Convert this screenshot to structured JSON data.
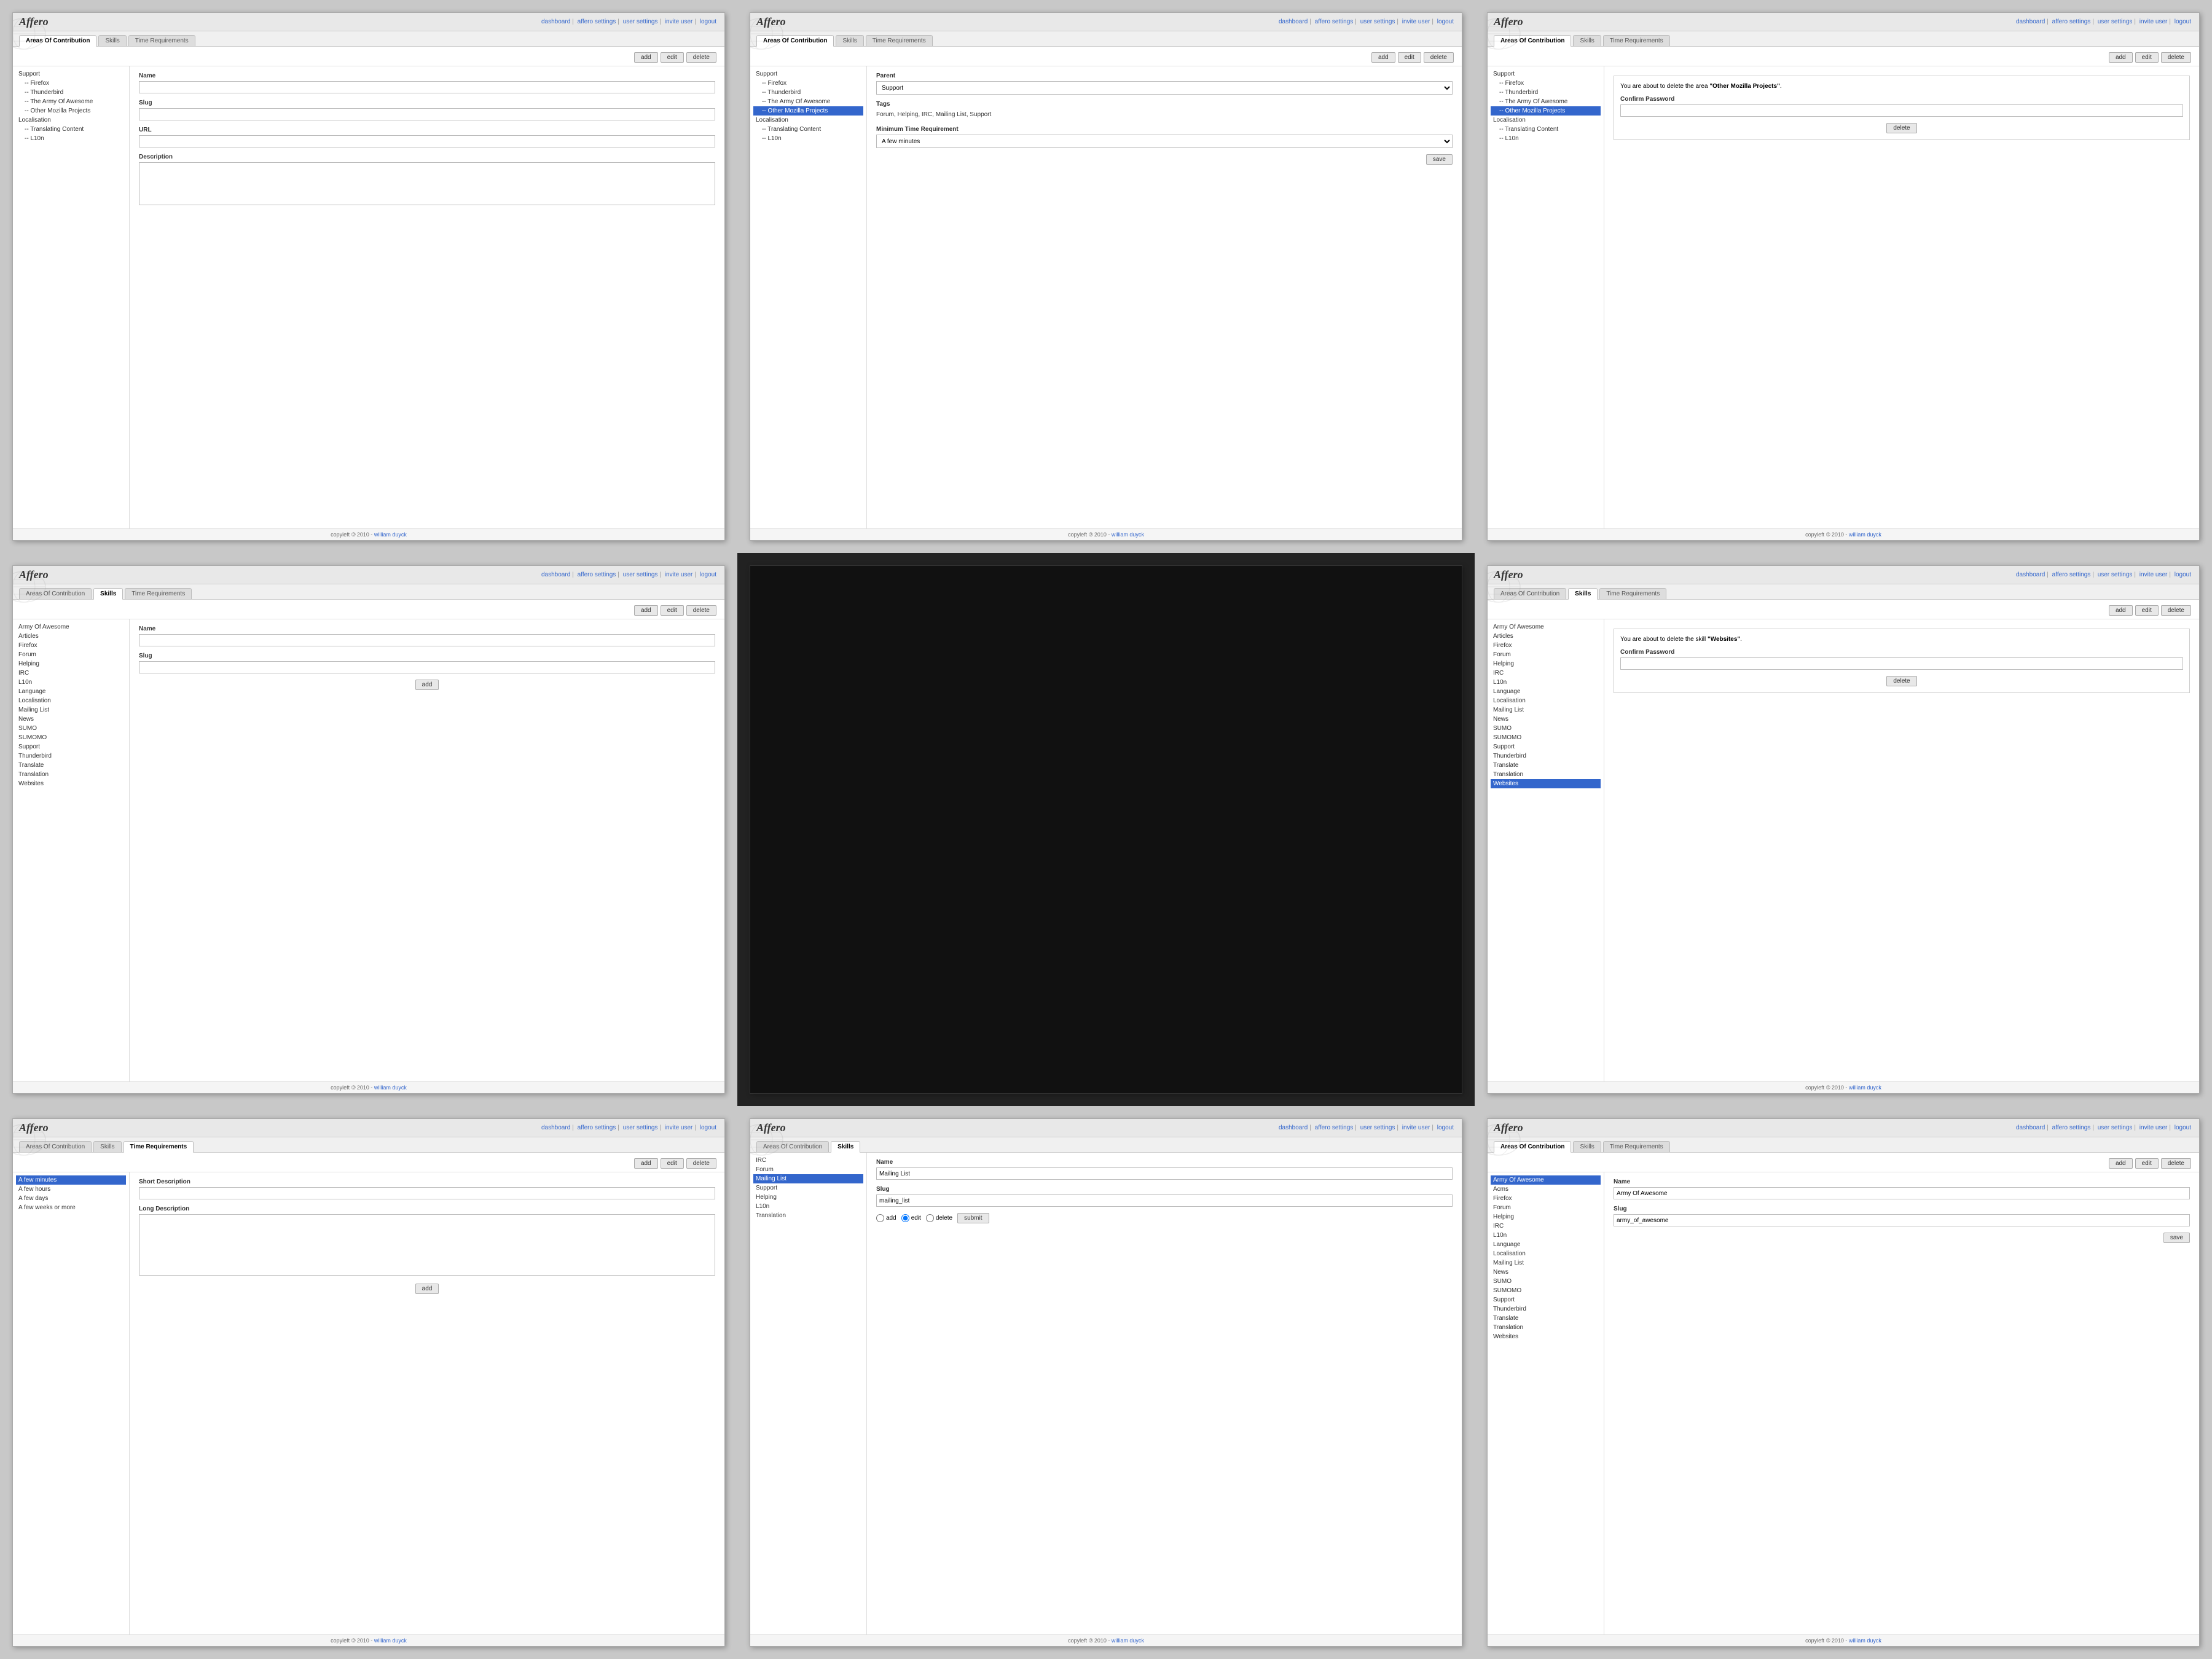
{
  "nav": {
    "links": [
      "dashboard",
      "affero settings",
      "user settings",
      "invite user",
      "logout"
    ]
  },
  "logo": "Affero",
  "tabs": {
    "areas": "Areas Of Contribution",
    "skills": "Skills",
    "time": "Time Requirements"
  },
  "footer": {
    "text": "copyleft",
    "year": "2010",
    "author": "william duyck"
  },
  "cells": [
    {
      "id": "cell-1",
      "activeTab": "areas",
      "list": [
        {
          "label": "Support",
          "indent": 0
        },
        {
          "label": "-- Firefox",
          "indent": 1
        },
        {
          "label": "-- Thunderbird",
          "indent": 1
        },
        {
          "label": "-- The Army Of Awesome",
          "indent": 1
        },
        {
          "label": "-- Other Mozilla Projects",
          "indent": 1
        },
        {
          "label": "Localisation",
          "indent": 0
        },
        {
          "label": "-- Translating Content",
          "indent": 1
        },
        {
          "label": "-- L10n",
          "indent": 1
        }
      ],
      "form": {
        "fields": [
          "Name",
          "Slug",
          "URL",
          "Description"
        ],
        "hasTextarea": true,
        "buttons": [
          "add",
          "edit",
          "delete"
        ]
      }
    },
    {
      "id": "cell-2",
      "activeTab": "areas",
      "list": [
        {
          "label": "Support",
          "indent": 0
        },
        {
          "label": "-- Firefox",
          "indent": 1
        },
        {
          "label": "-- Thunderbird",
          "indent": 1
        },
        {
          "label": "-- The Army Of Awesome",
          "indent": 1
        },
        {
          "label": "-- Other Mozilla Projects",
          "indent": 1,
          "selected": true
        },
        {
          "label": "Localisation",
          "indent": 0
        },
        {
          "label": "-- Translating Content",
          "indent": 1
        },
        {
          "label": "-- L10n",
          "indent": 1
        }
      ],
      "form": {
        "parent": "Support",
        "tags": "Forum, Helping, IRC, Mailing List, Support",
        "minTime": "A few minutes",
        "button": "save",
        "buttons": [
          "add",
          "edit",
          "delete"
        ]
      }
    },
    {
      "id": "cell-3",
      "activeTab": "areas",
      "list": [
        {
          "label": "Support",
          "indent": 0
        },
        {
          "label": "-- Firefox",
          "indent": 1
        },
        {
          "label": "-- Thunderbird",
          "indent": 1
        },
        {
          "label": "-- The Army Of Awesome",
          "indent": 1
        },
        {
          "label": "-- Other Mozilla Projects",
          "indent": 1,
          "selected": true
        },
        {
          "label": "Localisation",
          "indent": 0
        },
        {
          "label": "-- Translating Content",
          "indent": 1
        },
        {
          "label": "-- L10n",
          "indent": 1
        }
      ],
      "confirm": {
        "message": "You are about to delete the area \"Other Mozilla Projects\".",
        "label": "Confirm Password",
        "button": "delete"
      },
      "buttons": [
        "add",
        "edit",
        "delete"
      ]
    },
    {
      "id": "cell-4",
      "activeTab": "skills",
      "list": [
        "Army Of Awesome",
        "Articles",
        "Firefox",
        "Forum",
        "Helping",
        "IRC",
        "L10n",
        "Language",
        "Localisation",
        "Mailing List",
        "News",
        "SUMO",
        "SUMOMO",
        "Support",
        "Thunderbird",
        "Translate",
        "Translation",
        "Websites"
      ],
      "form": {
        "fields": [
          "Name",
          "Slug"
        ],
        "button": "add",
        "buttons": [
          "add",
          "edit",
          "delete"
        ]
      }
    },
    {
      "id": "cell-5",
      "type": "black"
    },
    {
      "id": "cell-6",
      "activeTab": "skills",
      "list": [
        "Army Of Awesome",
        "Articles",
        "Firefox",
        "Forum",
        "Helping",
        "IRC",
        "L10n",
        "Language",
        "Localisation",
        "Mailing List",
        "News",
        "SUMO",
        "SUMOMO",
        "Support",
        "Thunderbird",
        "Translate",
        "Translation",
        "Websites"
      ],
      "selectedItem": "Websites",
      "confirm": {
        "message": "You are about to delete the skill \"Websites\".",
        "label": "Confirm Password",
        "button": "delete"
      },
      "buttons": [
        "add",
        "edit",
        "delete"
      ]
    },
    {
      "id": "cell-7",
      "activeTab": "time",
      "list": [
        {
          "label": "A few minutes",
          "selected": true
        },
        {
          "label": "A few hours"
        },
        {
          "label": "A few days"
        },
        {
          "label": "A few weeks or more"
        }
      ],
      "form": {
        "fields": [
          "Short Description",
          "Long Description"
        ],
        "hasTextarea": true,
        "button": "add",
        "buttons": [
          "add",
          "edit",
          "delete"
        ]
      }
    },
    {
      "id": "cell-8",
      "activeTab": "areas_skills",
      "tabs": [
        "Areas Of Contribution",
        "Skills"
      ],
      "activeTabIndex": 1,
      "list": [
        {
          "label": "IRC"
        },
        {
          "label": "Forum"
        },
        {
          "label": "Mailing List",
          "selected": true
        },
        {
          "label": "Support"
        },
        {
          "label": "Helping"
        },
        {
          "label": "L10n"
        },
        {
          "label": "Translation"
        }
      ],
      "form": {
        "nameVal": "Mailing List",
        "slugVal": "mailing_list",
        "radioOptions": [
          "add",
          "edit",
          "delete"
        ],
        "button": "submit"
      }
    },
    {
      "id": "cell-9",
      "activeTab": "areas",
      "list": [
        {
          "label": "Army Of Awesome",
          "selected": true
        },
        {
          "label": "Acms"
        },
        {
          "label": "Firefox"
        },
        {
          "label": "Forum"
        },
        {
          "label": "Helping"
        },
        {
          "label": "IRC"
        },
        {
          "label": "L10n"
        },
        {
          "label": "Language"
        },
        {
          "label": "Localisation"
        },
        {
          "label": "Mailing List"
        },
        {
          "label": "News"
        },
        {
          "label": "SUMO"
        },
        {
          "label": "SUMOMO"
        },
        {
          "label": "Support"
        },
        {
          "label": "Thunderbird"
        },
        {
          "label": "Translate"
        },
        {
          "label": "Translation"
        },
        {
          "label": "Websites"
        }
      ],
      "form": {
        "nameVal": "Army Of Awesome",
        "slugVal": "army_of_awesome",
        "button": "save",
        "buttons": [
          "add",
          "edit",
          "delete"
        ]
      }
    }
  ]
}
